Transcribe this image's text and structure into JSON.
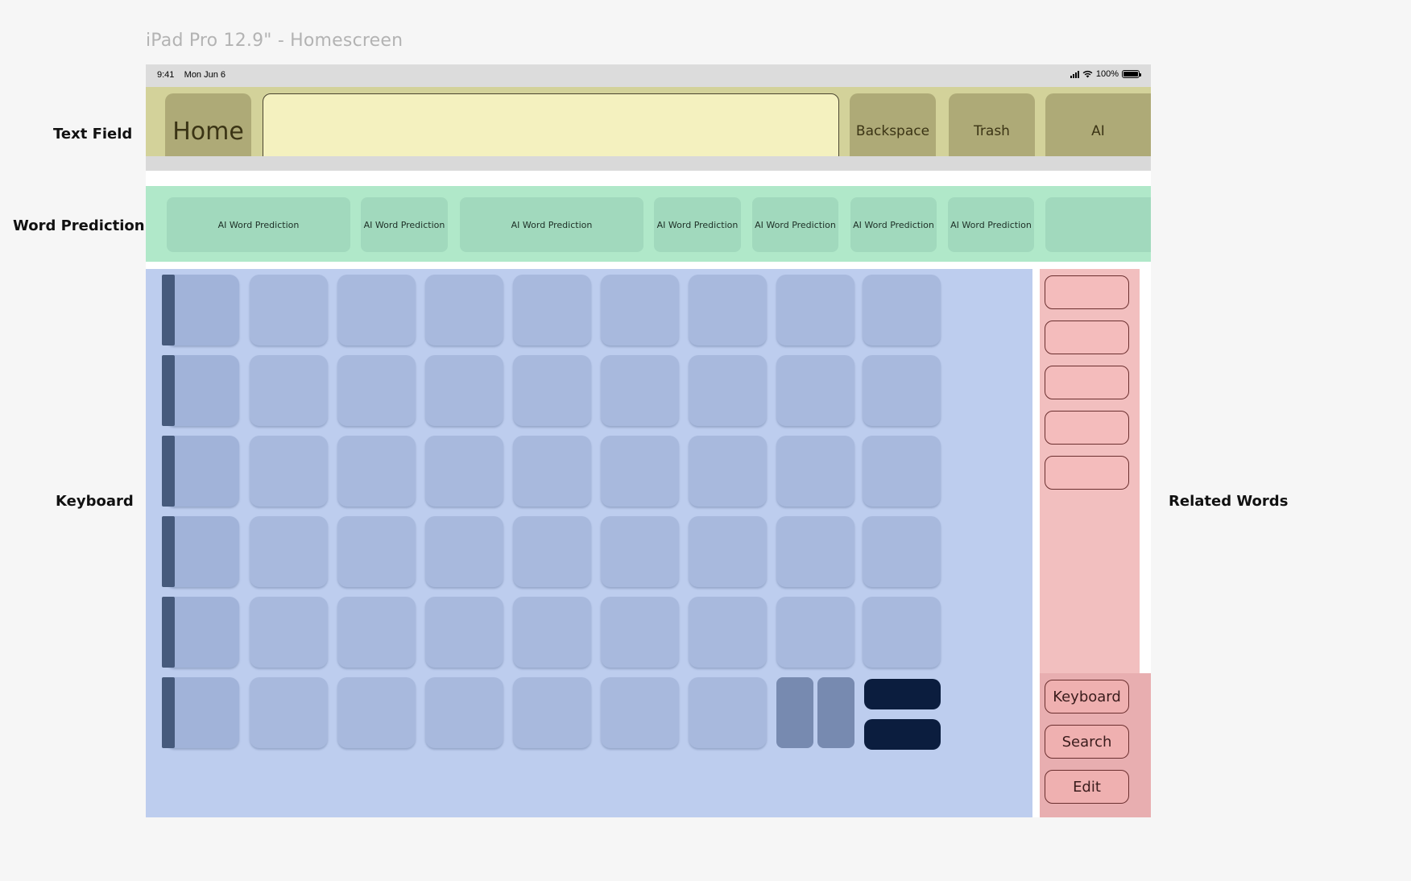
{
  "frame_title": "iPad Pro 12.9\" - Homescreen",
  "side_labels": {
    "text_field": "Text Field",
    "word_prediction": "Word Prediction",
    "keyboard": "Keyboard",
    "related_words": "Related Words"
  },
  "status_bar": {
    "time": "9:41",
    "date": "Mon Jun 6",
    "battery": "100%"
  },
  "text_field_bar": {
    "home_label": "Home",
    "input_value": "",
    "backspace_label": "Backspace",
    "trash_label": "Trash",
    "ai_label": "AI"
  },
  "word_prediction": {
    "items": [
      "AI Word Prediction",
      "AI Word Prediction",
      "AI Word Prediction",
      "AI Word Prediction",
      "AI Word Prediction",
      "AI Word Prediction",
      "AI Word Prediction",
      ""
    ]
  },
  "related_words": {
    "items": [
      "",
      "",
      "",
      "",
      ""
    ],
    "actions": {
      "keyboard_label": "Keyboard",
      "search_label": "Search",
      "edit_label": "Edit"
    }
  },
  "colors": {
    "text_field_bar": "#d3d29a",
    "text_field_button": "#aeaa77",
    "text_input": "#f4f1bf",
    "prediction_bar": "#b0e8c9",
    "prediction_button": "#a1d9bd",
    "keyboard_bg": "#bdcdee",
    "key": "#a8b9dd",
    "key_handle": "#465a7c",
    "key_navy": "#0b1d3e",
    "related_bg": "#f2bfbf"
  }
}
